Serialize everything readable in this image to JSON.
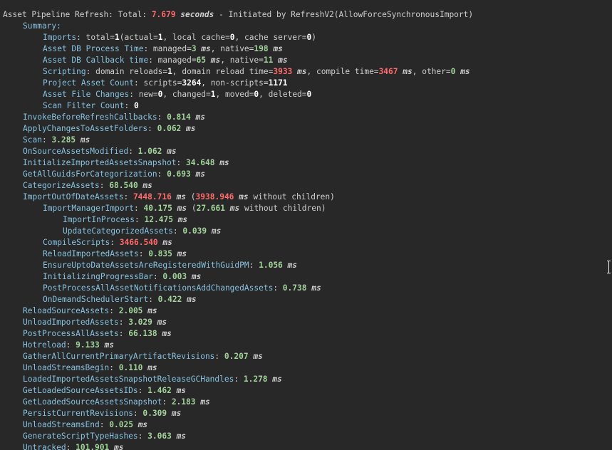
{
  "header": {
    "prefix": "Asset Pipeline Refresh: Total: ",
    "total": "7.679",
    "unit": "seconds",
    "suffix": " - Initiated by RefreshV2(AllowForceSynchronousImport)"
  },
  "lines": [
    {
      "level": 1,
      "parts": [
        {
          "s": "k",
          "t": "Summary:"
        }
      ]
    },
    {
      "level": 2,
      "parts": [
        {
          "s": "k",
          "t": "Imports"
        },
        {
          "s": "t",
          "t": ": total="
        },
        {
          "s": "w",
          "t": "1"
        },
        {
          "s": "t",
          "t": "(actual="
        },
        {
          "s": "w",
          "t": "1"
        },
        {
          "s": "t",
          "t": ", local cache="
        },
        {
          "s": "w",
          "t": "0"
        },
        {
          "s": "t",
          "t": ", cache server="
        },
        {
          "s": "w",
          "t": "0"
        },
        {
          "s": "t",
          "t": ")"
        }
      ]
    },
    {
      "level": 2,
      "parts": [
        {
          "s": "k",
          "t": "Asset DB Process Time"
        },
        {
          "s": "t",
          "t": ": managed="
        },
        {
          "s": "g",
          "t": "3"
        },
        {
          "s": "u",
          "t": " ms"
        },
        {
          "s": "t",
          "t": ", native="
        },
        {
          "s": "g",
          "t": "198"
        },
        {
          "s": "u",
          "t": " ms"
        }
      ]
    },
    {
      "level": 2,
      "parts": [
        {
          "s": "k",
          "t": "Asset DB Callback time"
        },
        {
          "s": "t",
          "t": ": managed="
        },
        {
          "s": "g",
          "t": "65"
        },
        {
          "s": "u",
          "t": " ms"
        },
        {
          "s": "t",
          "t": ", native="
        },
        {
          "s": "g",
          "t": "11"
        },
        {
          "s": "u",
          "t": " ms"
        }
      ]
    },
    {
      "level": 2,
      "parts": [
        {
          "s": "k",
          "t": "Scripting"
        },
        {
          "s": "t",
          "t": ": domain reloads="
        },
        {
          "s": "w",
          "t": "1"
        },
        {
          "s": "t",
          "t": ", domain reload time="
        },
        {
          "s": "r",
          "t": "3933"
        },
        {
          "s": "u",
          "t": " ms"
        },
        {
          "s": "t",
          "t": ", compile time="
        },
        {
          "s": "r",
          "t": "3467"
        },
        {
          "s": "u",
          "t": " ms"
        },
        {
          "s": "t",
          "t": ", other="
        },
        {
          "s": "g",
          "t": "0"
        },
        {
          "s": "u",
          "t": " ms"
        }
      ]
    },
    {
      "level": 2,
      "parts": [
        {
          "s": "k",
          "t": "Project Asset Count"
        },
        {
          "s": "t",
          "t": ": scripts="
        },
        {
          "s": "w",
          "t": "3264"
        },
        {
          "s": "t",
          "t": ", non-scripts="
        },
        {
          "s": "w",
          "t": "1171"
        }
      ]
    },
    {
      "level": 2,
      "parts": [
        {
          "s": "k",
          "t": "Asset File Changes"
        },
        {
          "s": "t",
          "t": ": new="
        },
        {
          "s": "w",
          "t": "0"
        },
        {
          "s": "t",
          "t": ", changed="
        },
        {
          "s": "w",
          "t": "1"
        },
        {
          "s": "t",
          "t": ", moved="
        },
        {
          "s": "w",
          "t": "0"
        },
        {
          "s": "t",
          "t": ", deleted="
        },
        {
          "s": "w",
          "t": "0"
        }
      ]
    },
    {
      "level": 2,
      "parts": [
        {
          "s": "k",
          "t": "Scan Filter Count"
        },
        {
          "s": "t",
          "t": ": "
        },
        {
          "s": "w",
          "t": "0"
        }
      ]
    },
    {
      "level": 1,
      "parts": [
        {
          "s": "k",
          "t": "InvokeBeforeRefreshCallbacks"
        },
        {
          "s": "t",
          "t": ": "
        },
        {
          "s": "g",
          "t": "0.814"
        },
        {
          "s": "u",
          "t": " ms"
        }
      ]
    },
    {
      "level": 1,
      "parts": [
        {
          "s": "k",
          "t": "ApplyChangesToAssetFolders"
        },
        {
          "s": "t",
          "t": ": "
        },
        {
          "s": "g",
          "t": "0.062"
        },
        {
          "s": "u",
          "t": " ms"
        }
      ]
    },
    {
      "level": 1,
      "parts": [
        {
          "s": "k",
          "t": "Scan"
        },
        {
          "s": "t",
          "t": ": "
        },
        {
          "s": "g",
          "t": "3.285"
        },
        {
          "s": "u",
          "t": " ms"
        }
      ]
    },
    {
      "level": 1,
      "parts": [
        {
          "s": "k",
          "t": "OnSourceAssetsModified"
        },
        {
          "s": "t",
          "t": ": "
        },
        {
          "s": "g",
          "t": "1.062"
        },
        {
          "s": "u",
          "t": " ms"
        }
      ]
    },
    {
      "level": 1,
      "parts": [
        {
          "s": "k",
          "t": "InitializeImportedAssetsSnapshot"
        },
        {
          "s": "t",
          "t": ": "
        },
        {
          "s": "g",
          "t": "34.648"
        },
        {
          "s": "u",
          "t": " ms"
        }
      ]
    },
    {
      "level": 1,
      "parts": [
        {
          "s": "k",
          "t": "GetAllGuidsForCategorization"
        },
        {
          "s": "t",
          "t": ": "
        },
        {
          "s": "g",
          "t": "0.693"
        },
        {
          "s": "u",
          "t": " ms"
        }
      ]
    },
    {
      "level": 1,
      "parts": [
        {
          "s": "k",
          "t": "CategorizeAssets"
        },
        {
          "s": "t",
          "t": ": "
        },
        {
          "s": "g",
          "t": "68.540"
        },
        {
          "s": "u",
          "t": " ms"
        }
      ]
    },
    {
      "level": 1,
      "parts": [
        {
          "s": "k",
          "t": "ImportOutOfDateAssets"
        },
        {
          "s": "t",
          "t": ": "
        },
        {
          "s": "r",
          "t": "7448.716"
        },
        {
          "s": "u",
          "t": " ms"
        },
        {
          "s": "t",
          "t": " ("
        },
        {
          "s": "r",
          "t": "3938.946"
        },
        {
          "s": "u",
          "t": " ms"
        },
        {
          "s": "t",
          "t": " without children)"
        }
      ]
    },
    {
      "level": 2,
      "parts": [
        {
          "s": "k",
          "t": "ImportManagerImport"
        },
        {
          "s": "t",
          "t": ": "
        },
        {
          "s": "g",
          "t": "40.175"
        },
        {
          "s": "u",
          "t": " ms"
        },
        {
          "s": "t",
          "t": " ("
        },
        {
          "s": "g",
          "t": "27.661"
        },
        {
          "s": "u",
          "t": " ms"
        },
        {
          "s": "t",
          "t": " without children)"
        }
      ]
    },
    {
      "level": 3,
      "parts": [
        {
          "s": "k",
          "t": "ImportInProcess"
        },
        {
          "s": "t",
          "t": ": "
        },
        {
          "s": "g",
          "t": "12.475"
        },
        {
          "s": "u",
          "t": " ms"
        }
      ]
    },
    {
      "level": 3,
      "parts": [
        {
          "s": "k",
          "t": "UpdateCategorizedAssets"
        },
        {
          "s": "t",
          "t": ": "
        },
        {
          "s": "g",
          "t": "0.039"
        },
        {
          "s": "u",
          "t": " ms"
        }
      ]
    },
    {
      "level": 2,
      "parts": [
        {
          "s": "k",
          "t": "CompileScripts"
        },
        {
          "s": "t",
          "t": ": "
        },
        {
          "s": "r",
          "t": "3466.540"
        },
        {
          "s": "u",
          "t": " ms"
        }
      ]
    },
    {
      "level": 2,
      "parts": [
        {
          "s": "k",
          "t": "ReloadImportedAssets"
        },
        {
          "s": "t",
          "t": ": "
        },
        {
          "s": "g",
          "t": "0.835"
        },
        {
          "s": "u",
          "t": " ms"
        }
      ]
    },
    {
      "level": 2,
      "parts": [
        {
          "s": "k",
          "t": "EnsureUptoDateAssetsAreRegisteredWithGuidPM"
        },
        {
          "s": "t",
          "t": ": "
        },
        {
          "s": "g",
          "t": "1.056"
        },
        {
          "s": "u",
          "t": " ms"
        }
      ]
    },
    {
      "level": 2,
      "parts": [
        {
          "s": "k",
          "t": "InitializingProgressBar"
        },
        {
          "s": "t",
          "t": ": "
        },
        {
          "s": "g",
          "t": "0.003"
        },
        {
          "s": "u",
          "t": " ms"
        }
      ]
    },
    {
      "level": 2,
      "parts": [
        {
          "s": "k",
          "t": "PostProcessAllAssetNotificationsAddChangedAssets"
        },
        {
          "s": "t",
          "t": ": "
        },
        {
          "s": "g",
          "t": "0.738"
        },
        {
          "s": "u",
          "t": " ms"
        }
      ]
    },
    {
      "level": 2,
      "parts": [
        {
          "s": "k",
          "t": "OnDemandSchedulerStart"
        },
        {
          "s": "t",
          "t": ": "
        },
        {
          "s": "g",
          "t": "0.422"
        },
        {
          "s": "u",
          "t": " ms"
        }
      ]
    },
    {
      "level": 1,
      "parts": [
        {
          "s": "k",
          "t": "ReloadSourceAssets"
        },
        {
          "s": "t",
          "t": ": "
        },
        {
          "s": "g",
          "t": "2.005"
        },
        {
          "s": "u",
          "t": " ms"
        }
      ]
    },
    {
      "level": 1,
      "parts": [
        {
          "s": "k",
          "t": "UnloadImportedAssets"
        },
        {
          "s": "t",
          "t": ": "
        },
        {
          "s": "g",
          "t": "3.029"
        },
        {
          "s": "u",
          "t": " ms"
        }
      ]
    },
    {
      "level": 1,
      "parts": [
        {
          "s": "k",
          "t": "PostProcessAllAssets"
        },
        {
          "s": "t",
          "t": ": "
        },
        {
          "s": "g",
          "t": "66.138"
        },
        {
          "s": "u",
          "t": " ms"
        }
      ]
    },
    {
      "level": 1,
      "parts": [
        {
          "s": "k",
          "t": "Hotreload"
        },
        {
          "s": "t",
          "t": ": "
        },
        {
          "s": "g",
          "t": "9.133"
        },
        {
          "s": "u",
          "t": " ms"
        }
      ]
    },
    {
      "level": 1,
      "parts": [
        {
          "s": "k",
          "t": "GatherAllCurrentPrimaryArtifactRevisions"
        },
        {
          "s": "t",
          "t": ": "
        },
        {
          "s": "g",
          "t": "0.207"
        },
        {
          "s": "u",
          "t": " ms"
        }
      ]
    },
    {
      "level": 1,
      "parts": [
        {
          "s": "k",
          "t": "UnloadStreamsBegin"
        },
        {
          "s": "t",
          "t": ": "
        },
        {
          "s": "g",
          "t": "0.110"
        },
        {
          "s": "u",
          "t": " ms"
        }
      ]
    },
    {
      "level": 1,
      "parts": [
        {
          "s": "k",
          "t": "LoadedImportedAssetsSnapshotReleaseGCHandles"
        },
        {
          "s": "t",
          "t": ": "
        },
        {
          "s": "g",
          "t": "1.278"
        },
        {
          "s": "u",
          "t": " ms"
        }
      ]
    },
    {
      "level": 1,
      "parts": [
        {
          "s": "k",
          "t": "GetLoadedSourceAssetsIDs"
        },
        {
          "s": "t",
          "t": ": "
        },
        {
          "s": "g",
          "t": "1.462"
        },
        {
          "s": "u",
          "t": " ms"
        }
      ]
    },
    {
      "level": 1,
      "parts": [
        {
          "s": "k",
          "t": "GetLoadedSourceAssetsSnapshot"
        },
        {
          "s": "t",
          "t": ": "
        },
        {
          "s": "g",
          "t": "2.183"
        },
        {
          "s": "u",
          "t": " ms"
        }
      ]
    },
    {
      "level": 1,
      "parts": [
        {
          "s": "k",
          "t": "PersistCurrentRevisions"
        },
        {
          "s": "t",
          "t": ": "
        },
        {
          "s": "g",
          "t": "0.309"
        },
        {
          "s": "u",
          "t": " ms"
        }
      ]
    },
    {
      "level": 1,
      "parts": [
        {
          "s": "k",
          "t": "UnloadStreamsEnd"
        },
        {
          "s": "t",
          "t": ": "
        },
        {
          "s": "g",
          "t": "0.025"
        },
        {
          "s": "u",
          "t": " ms"
        }
      ]
    },
    {
      "level": 1,
      "parts": [
        {
          "s": "k",
          "t": "GenerateScriptTypeHashes"
        },
        {
          "s": "t",
          "t": ": "
        },
        {
          "s": "g",
          "t": "3.063"
        },
        {
          "s": "u",
          "t": " ms"
        }
      ]
    },
    {
      "level": 1,
      "parts": [
        {
          "s": "k",
          "t": "Untracked"
        },
        {
          "s": "t",
          "t": ": "
        },
        {
          "s": "g",
          "t": "101.901"
        },
        {
          "s": "u",
          "t": " ms"
        }
      ]
    }
  ],
  "colors": {
    "background": "#282828",
    "key": "#87c2e0",
    "text": "#cfcfcf",
    "value_good": "#a2d39a",
    "value_slow": "#ff6b6b",
    "count": "#ffffff"
  },
  "icons": {
    "cursor": "text-cursor-icon"
  }
}
